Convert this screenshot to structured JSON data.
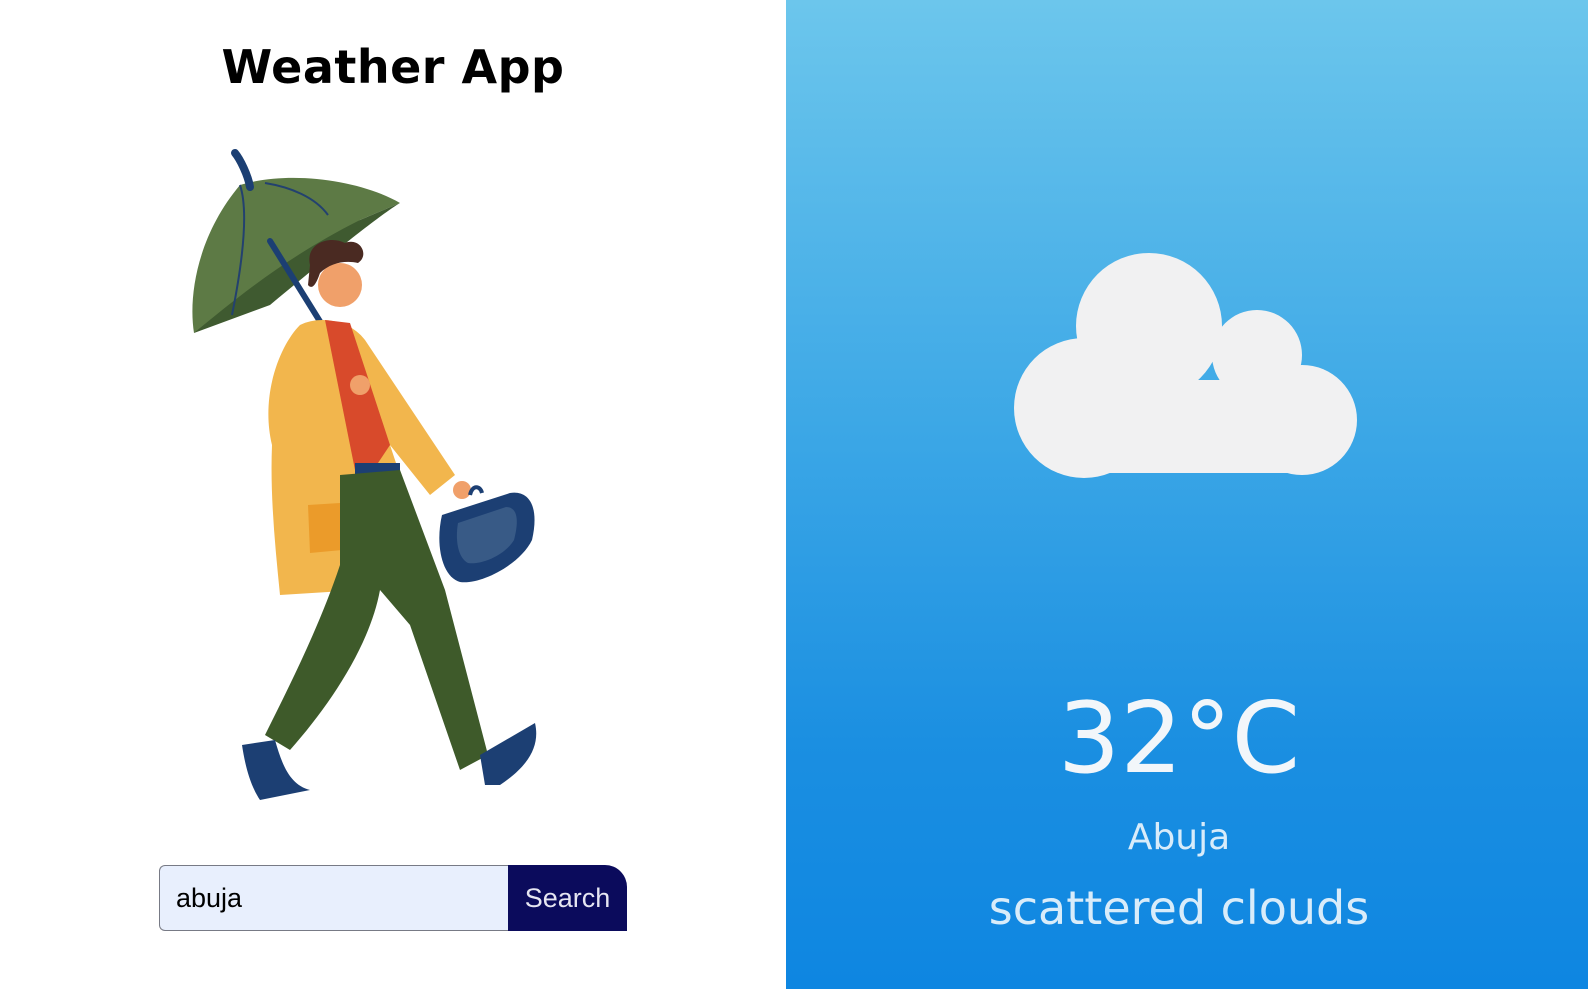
{
  "app": {
    "title": "Weather App"
  },
  "search": {
    "value": "abuja",
    "button_label": "Search"
  },
  "weather": {
    "icon": "cloud-icon",
    "temperature": "32°C",
    "city": "Abuja",
    "description": "scattered clouds"
  },
  "illustration": {
    "icon": "person-with-umbrella-illustration"
  },
  "colors": {
    "panel_gradient_top": "#6cc6ec",
    "panel_gradient_bottom": "#0e86e1",
    "search_button": "#0b0b5c",
    "search_input_bg": "#e8effd",
    "cloud": "#f1f1f2"
  }
}
